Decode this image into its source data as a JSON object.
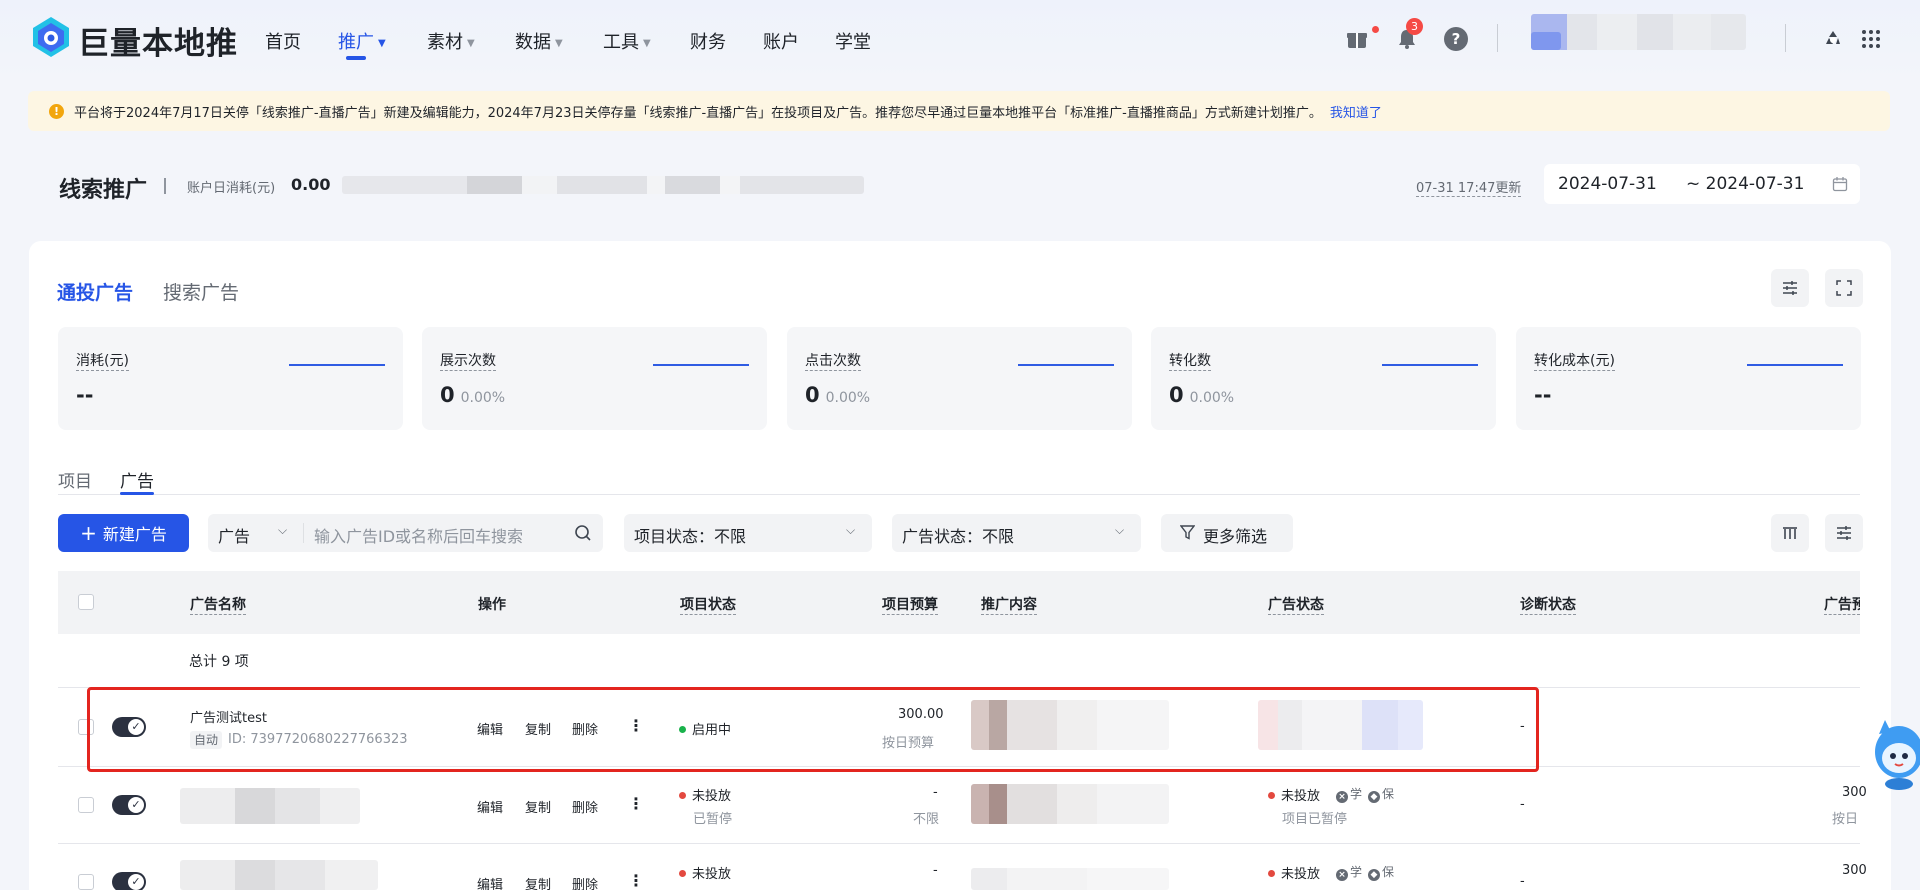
{
  "brand": {
    "name": "巨量本地推"
  },
  "nav": {
    "items": [
      {
        "label": "首页"
      },
      {
        "label": "推广"
      },
      {
        "label": "素材"
      },
      {
        "label": "数据"
      },
      {
        "label": "工具"
      },
      {
        "label": "财务"
      },
      {
        "label": "账户"
      },
      {
        "label": "学堂"
      }
    ],
    "active_index": 1,
    "notification_count": "3"
  },
  "notice": {
    "text": "平台将于2024年7月17日关停「线索推广-直播广告」新建及编辑能力，2024年7月23日关停存量「线索推广-直播广告」在投项目及广告。推荐您尽早通过巨量本地推平台「标准推广-直播推商品」方式新建计划推广。",
    "link": "我知道了"
  },
  "header": {
    "title": "线索推广",
    "account_label": "账户日消耗(元)",
    "account_value": "0.00",
    "updated": "07-31 17:47更新",
    "date_start": "2024-07-31",
    "date_end": "~ 2024-07-31"
  },
  "tabs": {
    "primary": "通投广告",
    "secondary": "搜索广告"
  },
  "stats": [
    {
      "label": "消耗(元)",
      "value": "--",
      "pct": ""
    },
    {
      "label": "展示次数",
      "value": "0",
      "pct": "0.00%"
    },
    {
      "label": "点击次数",
      "value": "0",
      "pct": "0.00%"
    },
    {
      "label": "转化数",
      "value": "0",
      "pct": "0.00%"
    },
    {
      "label": "转化成本(元)",
      "value": "--",
      "pct": ""
    }
  ],
  "subtabs": [
    "项目",
    "广告"
  ],
  "filters": {
    "new_button": "新建广告",
    "scope": "广告",
    "search_placeholder": "输入广告ID或名称后回车搜索",
    "project_status": "项目状态：不限",
    "ad_status": "广告状态：不限",
    "more": "更多筛选"
  },
  "table": {
    "columns": [
      "广告名称",
      "操作",
      "项目状态",
      "项目预算",
      "推广内容",
      "广告状态",
      "诊断状态",
      "广告预"
    ],
    "total": "总计 9 项",
    "ops": [
      "编辑",
      "复制",
      "删除"
    ],
    "rows": [
      {
        "name": "广告测试test",
        "tag": "自动",
        "id": "ID: 7397720680227766323",
        "project_status": "启用中",
        "project_sub": "",
        "budget": "300.00",
        "budget_sub": "按日预算",
        "ad_status": "",
        "ad_sub": "",
        "diag": "-",
        "ad_budget": "",
        "ad_budget_sub": ""
      },
      {
        "name": "",
        "tag": "",
        "id": "",
        "project_status": "未投放",
        "project_sub": "已暂停",
        "budget": "-",
        "budget_sub": "不限",
        "ad_status": "未投放",
        "ad_sub": "项目已暂停",
        "ad_tags": [
          "学",
          "保"
        ],
        "diag": "-",
        "ad_budget": "300",
        "ad_budget_sub": "按日"
      },
      {
        "name": "",
        "tag": "",
        "id": "",
        "project_status": "未投放",
        "project_sub": "",
        "budget": "-",
        "budget_sub": "",
        "ad_status": "未投放",
        "ad_sub": "",
        "ad_tags": [
          "学",
          "保"
        ],
        "diag": "-",
        "ad_budget": "300",
        "ad_budget_sub": ""
      }
    ]
  },
  "colors": {
    "accent": "#2655e6",
    "highlight": "#e3251f",
    "running": "#19b24b",
    "stopped": "#e3493f"
  }
}
